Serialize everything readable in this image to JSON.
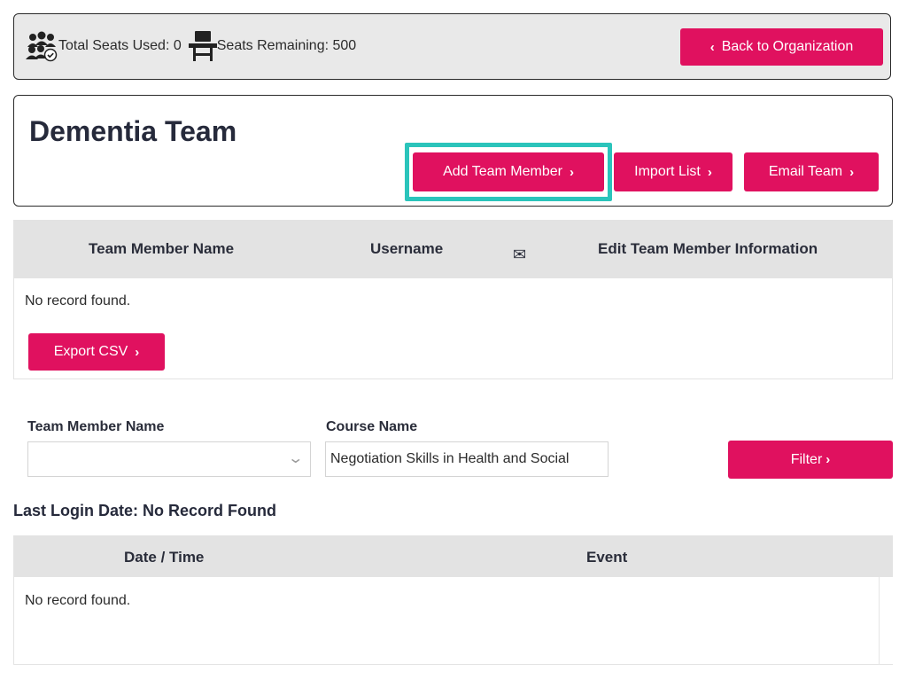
{
  "seats": {
    "used_label": "Total Seats Used: 0",
    "remaining_label": "Seats Remaining: 500",
    "back_button": "Back to Organization"
  },
  "team": {
    "title": "Dementia Team",
    "add_member_button": "Add Team Member",
    "import_button": "Import List",
    "email_button": "Email Team"
  },
  "members_table": {
    "columns": [
      "Team Member Name",
      "Username",
      "Edit Team Member Information"
    ],
    "empty_text": "No record found.",
    "export_button": "Export CSV"
  },
  "filters": {
    "member_label": "Team Member Name",
    "member_value": "",
    "course_label": "Course Name",
    "course_value": "Negotiation Skills in Health and Social",
    "filter_button": "Filter"
  },
  "login": {
    "title": "Last Login Date: No Record Found",
    "columns": [
      "Date / Time",
      "Event"
    ],
    "empty_text": "No record found."
  },
  "colors": {
    "accent": "#e0115f",
    "highlight": "#2bc4bb",
    "header_gray": "#e3e3e3"
  },
  "icons": {
    "seats_used": "people-check-icon",
    "seats_remaining": "desk-chair-icon",
    "email": "envelope-icon"
  }
}
